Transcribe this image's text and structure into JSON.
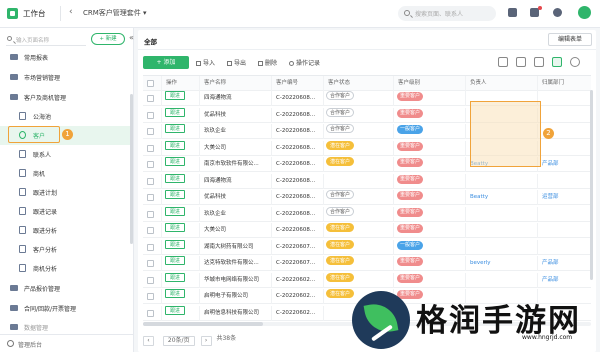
{
  "topbar": {
    "workspace": "工作台",
    "back_icon": "chevron-left-icon",
    "title": "CRM客户管理套件",
    "title_caret": "▾",
    "search_placeholder": "搜索页面、联系人"
  },
  "sidebar": {
    "search_placeholder": "输入页面名称",
    "new_button": "+ 新建",
    "collapse": "«",
    "items": [
      {
        "label": "常用报表",
        "type": "folder"
      },
      {
        "label": "市场营销管理",
        "type": "folder"
      },
      {
        "label": "客户及商机管理",
        "type": "folder"
      },
      {
        "label": "公海池",
        "type": "sub"
      },
      {
        "label": "客户",
        "type": "sub",
        "active": true
      },
      {
        "label": "联系人",
        "type": "sub"
      },
      {
        "label": "商机",
        "type": "sub"
      },
      {
        "label": "跟进计划",
        "type": "sub"
      },
      {
        "label": "跟进记录",
        "type": "sub"
      },
      {
        "label": "跟进分析",
        "type": "sub"
      },
      {
        "label": "客户分析",
        "type": "sub"
      },
      {
        "label": "商机分析",
        "type": "sub"
      },
      {
        "label": "产品报价管理",
        "type": "folder"
      },
      {
        "label": "合同/回款/开票管理",
        "type": "folder"
      },
      {
        "label": "数据管理",
        "type": "folder"
      }
    ],
    "badge1": "1",
    "footer": "管理后台"
  },
  "main": {
    "breadcrumb": "全部",
    "edit_form": "编辑表单",
    "add_button": "+ 添加",
    "tools": [
      "导入",
      "导出",
      "删除",
      "操作记录"
    ],
    "badge2": "2"
  },
  "table": {
    "headers": [
      "操作",
      "客户名称",
      "客户编号",
      "客户状态",
      "客户级别",
      "负责人",
      "归属部门"
    ],
    "action_label": "跟进",
    "rows": [
      {
        "name": "四海通物流",
        "id": "C-20220608...",
        "status": "合作客户",
        "level": "重要客户",
        "owner": "",
        "dept": ""
      },
      {
        "name": "优品科技",
        "id": "C-20220608...",
        "status": "合作客户",
        "level": "重要客户",
        "owner": "",
        "dept": ""
      },
      {
        "name": "玖玖企业",
        "id": "C-20220608...",
        "status": "合作客户",
        "level": "一般客户",
        "owner": "",
        "dept": ""
      },
      {
        "name": "大美公司",
        "id": "C-20220608...",
        "status": "潜在客户",
        "level": "重要客户",
        "owner": "",
        "dept": ""
      },
      {
        "name": "南京市软软件有限公...",
        "id": "C-20220608...",
        "status": "潜在客户",
        "level": "重要客户",
        "owner": "Beatty",
        "dept": "产品部"
      },
      {
        "name": "四海通物流",
        "id": "C-20220608...",
        "status": "",
        "level": "重要客户",
        "owner": "",
        "dept": ""
      },
      {
        "name": "优品科技",
        "id": "C-20220608...",
        "status": "合作客户",
        "level": "重要客户",
        "owner": "Beatty",
        "dept": "运营部"
      },
      {
        "name": "玖玖企业",
        "id": "C-20220608...",
        "status": "合作客户",
        "level": "重要客户",
        "owner": "",
        "dept": ""
      },
      {
        "name": "大美公司",
        "id": "C-20220608...",
        "status": "潜在客户",
        "level": "重要客户",
        "owner": "",
        "dept": ""
      },
      {
        "name": "湖南大树药有限公司",
        "id": "C-20220607...",
        "status": "潜在客户",
        "level": "一般客户",
        "owner": "",
        "dept": ""
      },
      {
        "name": "达克特软软件有限公...",
        "id": "C-20220607...",
        "status": "潜在客户",
        "level": "重要客户",
        "owner": "beverly",
        "dept": "产品部"
      },
      {
        "name": "华城市电网络有限公司",
        "id": "C-20220602...",
        "status": "潜在客户",
        "level": "重要客户",
        "owner": "",
        "dept": "产品部"
      },
      {
        "name": "启明电子有限公司",
        "id": "C-20220602...",
        "status": "潜在客户",
        "level": "重要客户",
        "owner": "",
        "dept": ""
      },
      {
        "name": "启明信息科技有限公司",
        "id": "C-20220602...",
        "status": "",
        "level": "",
        "owner": "",
        "dept": ""
      }
    ]
  },
  "pager": {
    "prev": "‹",
    "page_size": "20条/页",
    "next": "›",
    "total": "共38条"
  },
  "watermark": {
    "text": "格润手游网",
    "url": "www.hngrjd.com"
  },
  "colors": {
    "accent": "#2fb56b",
    "highlight": "#f0a33a",
    "important": "#f08c8c",
    "normal": "#4aa3e8",
    "potential": "#f5bf3a"
  }
}
